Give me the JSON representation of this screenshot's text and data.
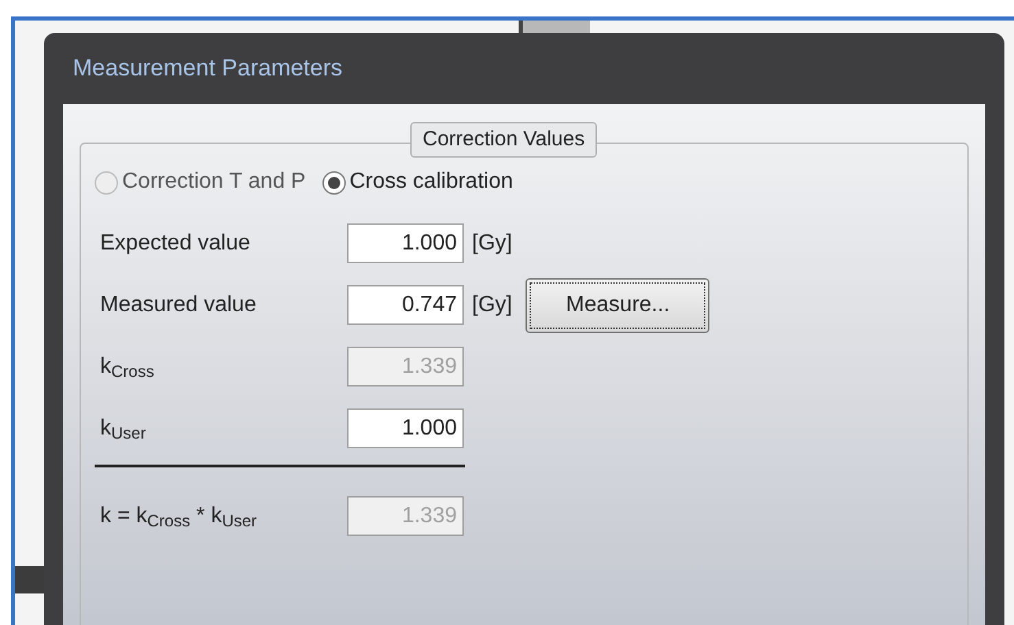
{
  "window": {
    "title": "Measurement Parameters"
  },
  "group": {
    "title": "Correction Values"
  },
  "modes": [
    {
      "label": "Correction T and P",
      "selected": false,
      "disabled": true
    },
    {
      "label": "Cross calibration",
      "selected": true,
      "disabled": false
    }
  ],
  "rows": [
    {
      "label": "Expected value",
      "value": "1.000",
      "disabled": false,
      "unit": "[Gy]"
    },
    {
      "label": "Measured value",
      "value": "0.747",
      "disabled": false,
      "unit": "[Gy]",
      "button": "Measure..."
    },
    {
      "label": "k$_{Cross}$",
      "value": "1.339",
      "disabled": true
    },
    {
      "label": "k$_{User}$",
      "value": "1.000",
      "disabled": false
    }
  ],
  "result": {
    "label": "k = k$_{Cross}$ * k$_{User}$",
    "value": "1.339",
    "disabled": true
  }
}
